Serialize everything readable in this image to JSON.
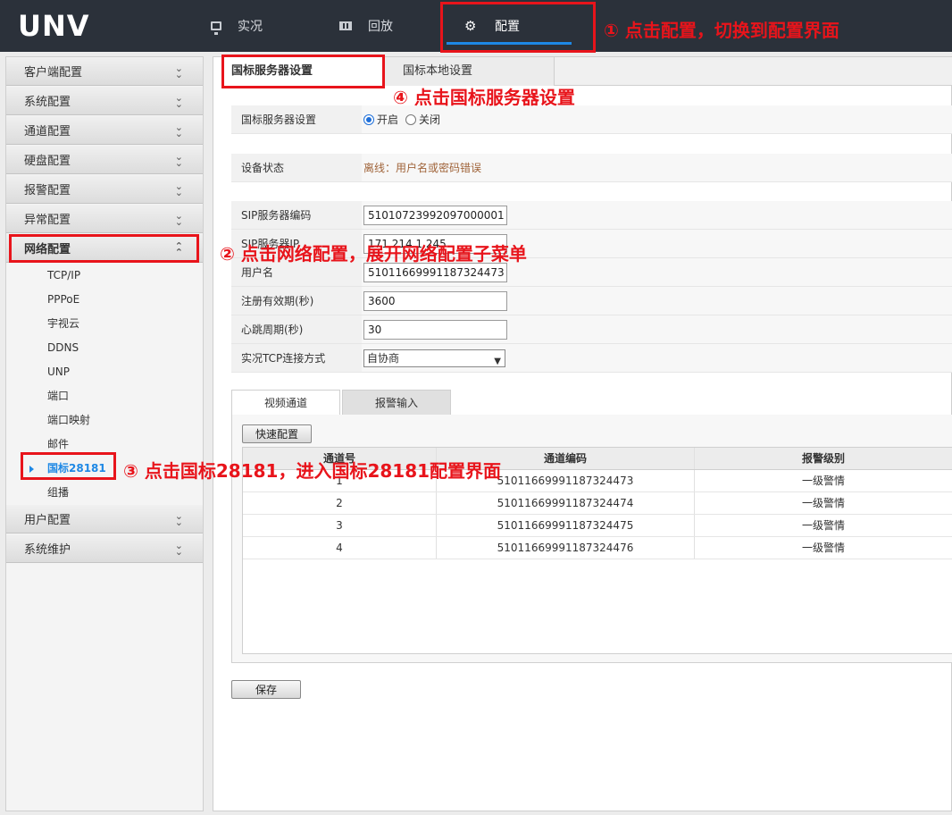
{
  "header": {
    "logo": "UNV",
    "nav": [
      {
        "label": "实况",
        "icon": "monitor-icon"
      },
      {
        "label": "回放",
        "icon": "film-icon"
      },
      {
        "label": "配置",
        "icon": "gear-icon",
        "active": true
      }
    ]
  },
  "sidebar": {
    "menus_top": [
      "客户端配置",
      "系统配置",
      "通道配置",
      "硬盘配置",
      "报警配置",
      "异常配置"
    ],
    "expanded": {
      "label": "网络配置",
      "items": [
        "TCP/IP",
        "PPPoE",
        "宇视云",
        "DDNS",
        "UNP",
        "端口",
        "端口映射",
        "邮件",
        "国标28181",
        "组播"
      ],
      "active_item": "国标28181"
    },
    "menus_bottom": [
      "用户配置",
      "系统维护"
    ]
  },
  "tabs": [
    "国标服务器设置",
    "国标本地设置"
  ],
  "form": {
    "server_setting": {
      "label": "国标服务器设置",
      "on": "开启",
      "off": "关闭",
      "value": "开启"
    },
    "device_status": {
      "label": "设备状态",
      "value": "离线：用户名或密码错误"
    },
    "sip_code": {
      "label": "SIP服务器编码",
      "value": "51010723992097000001"
    },
    "sip_ip": {
      "label": "SIP服务器IP",
      "value": "171.214.1.245"
    },
    "username": {
      "label": "用户名",
      "value": "51011669991187324473"
    },
    "reg_valid": {
      "label": "注册有效期(秒)",
      "value": "3600"
    },
    "heartbeat": {
      "label": "心跳周期(秒)",
      "value": "30"
    },
    "tcp_mode": {
      "label": "实况TCP连接方式",
      "value": "自协商"
    }
  },
  "subtabs": [
    "视频通道",
    "报警输入"
  ],
  "table": {
    "quick_btn": "快速配置",
    "headers": [
      "通道号",
      "通道编码",
      "报警级别"
    ],
    "rows": [
      [
        "1",
        "51011669991187324473",
        "一级警情"
      ],
      [
        "2",
        "51011669991187324474",
        "一级警情"
      ],
      [
        "3",
        "51011669991187324475",
        "一级警情"
      ],
      [
        "4",
        "51011669991187324476",
        "一级警情"
      ]
    ]
  },
  "save_label": "保存",
  "annotations": {
    "a1": "① 点击配置，切换到配置界面",
    "a2": "② 点击网络配置，展开网络配置子菜单",
    "a3": "③ 点击国标28181，进入国标28181配置界面",
    "a4": "④ 点击国标服务器设置"
  },
  "colors": {
    "topbar": "#2b313a",
    "accent": "#1e88e5",
    "annotation": "#e8141b",
    "status": "#a0643a"
  }
}
